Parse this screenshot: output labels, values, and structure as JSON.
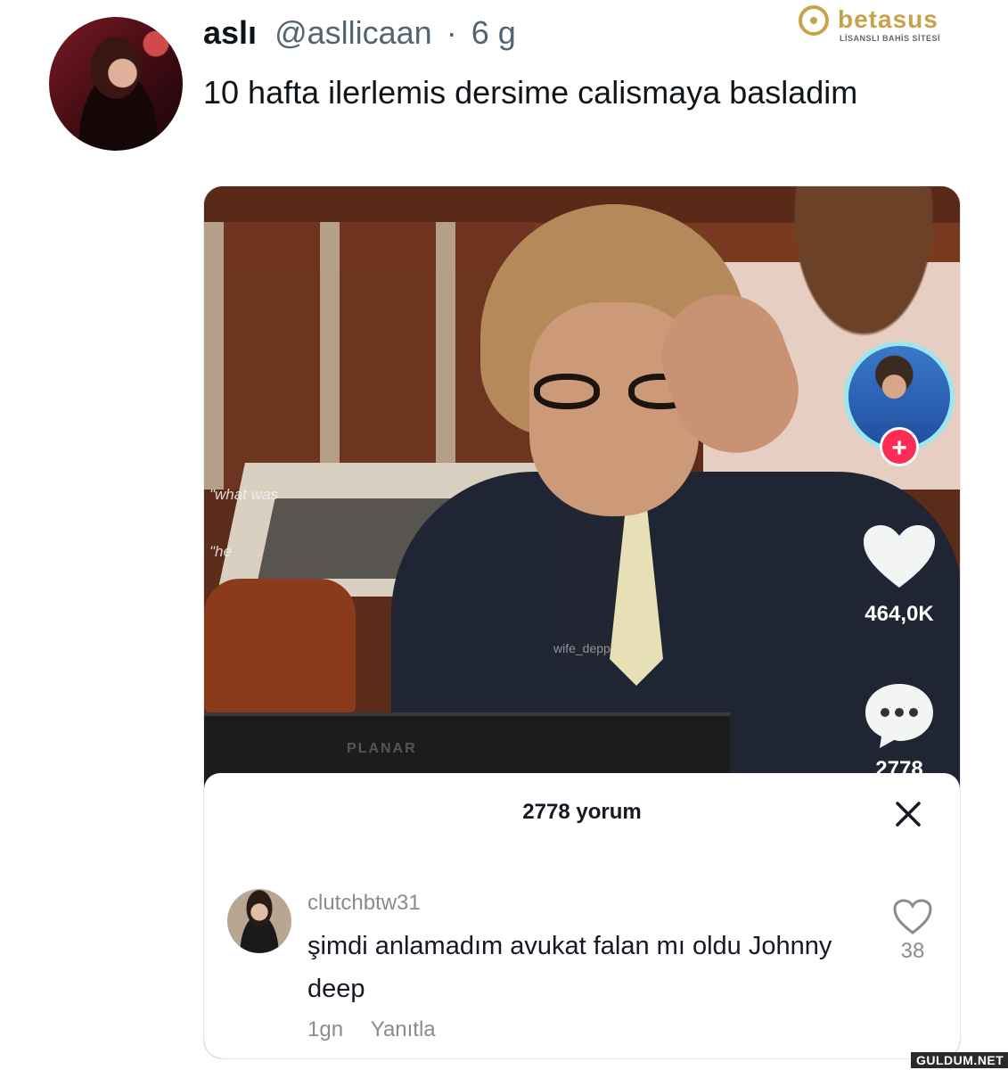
{
  "tweet": {
    "name": "aslı",
    "handle": "@asllicaan",
    "separator": "·",
    "time": "6 g",
    "text": "10 hafta ilerlemis dersime calismaya basladim"
  },
  "brand": {
    "name": "betasus",
    "tagline": "LİSANSLI BAHİS SİTESİ"
  },
  "video": {
    "caption_1": "\"what was",
    "caption_2": "\"he",
    "watermark": "wife_depp",
    "screen_label": "PLANAR",
    "likes": "464,0K",
    "comments": "2778",
    "follow_symbol": "+"
  },
  "comment_sheet": {
    "title": "2778 yorum",
    "comment": {
      "user": "clutchbtw31",
      "text": "şimdi anlamadım avukat falan mı oldu Johnny deep",
      "age": "1gn",
      "reply": "Yanıtla",
      "likes": "38"
    }
  },
  "footer": {
    "watermark": "GULDUM.NET"
  },
  "icons": {
    "like": "heart-icon",
    "comment": "speech-bubble-icon",
    "close": "close-icon",
    "comment_like": "heart-outline-icon"
  },
  "colors": {
    "accent": "#fe2c55",
    "brand": "#c8a24a"
  }
}
